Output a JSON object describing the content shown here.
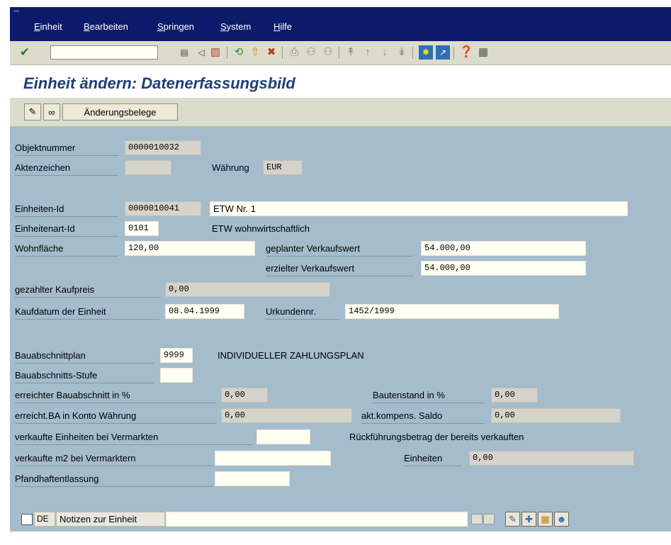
{
  "menu": {
    "items": [
      "Einheit",
      "Bearbeiten",
      "Springen",
      "System",
      "Hilfe"
    ]
  },
  "toolbar": {
    "command_value": ""
  },
  "title": "Einheit ändern: Datenerfassungsbild",
  "app_toolbar": {
    "aenderungsbelege": "Änderungsbelege"
  },
  "form": {
    "objektnummer": {
      "label": "Objektnummer",
      "value": "0000010032"
    },
    "aktenzeichen": {
      "label": "Aktenzeichen",
      "value": ""
    },
    "waehrung": {
      "label": "Währung",
      "value": "EUR"
    },
    "einheiten_id": {
      "label": "Einheiten-Id",
      "value": "0000010041",
      "text": "ETW Nr. 1"
    },
    "einheitenart_id": {
      "label": "Einheitenart-Id",
      "value": "0101",
      "text": "ETW wohnwirtschaftlich"
    },
    "wohnflaeche": {
      "label": "Wohnfläche",
      "value": "120,00"
    },
    "geplanter_vkw": {
      "label": "geplanter Verkaufswert",
      "value": "54.000,00"
    },
    "erzielter_vkw": {
      "label": "erzielter Verkaufswert",
      "value": "54.000,00"
    },
    "gezahlter_kaufpreis": {
      "label": "gezahlter Kaufpreis",
      "value": "0,00"
    },
    "kaufdatum": {
      "label": "Kaufdatum der Einheit",
      "value": "08.04.1999"
    },
    "urkundennr": {
      "label": "Urkundennr.",
      "value": "1452/1999"
    },
    "bauabschnittplan": {
      "label": "Bauabschnittplan",
      "value": "9999",
      "text": "INDIVIDUELLER ZAHLUNGSPLAN"
    },
    "bauabschnitts_stufe": {
      "label": "Bauabschnitts-Stufe",
      "value": ""
    },
    "erreichter_ba": {
      "label": "erreichter Bauabschnitt in %",
      "value": "0,00"
    },
    "bautenstand": {
      "label": "Bautenstand in %",
      "value": "0,00"
    },
    "erreicht_ba_konto": {
      "label": "erreicht.BA in Konto Währung",
      "value": "0,00"
    },
    "akt_kompens": {
      "label": "akt.kompens. Saldo",
      "value": "0,00"
    },
    "verkaufte_einheiten": {
      "label": "verkaufte Einheiten bei Vermarkten",
      "value": ""
    },
    "rueckfuehrung": {
      "label": "Rückführungsbetrag der bereits verkauften",
      "label2": "Einheiten",
      "value": "0,00"
    },
    "verkaufte_m2": {
      "label": "verkaufte m2 bei Vermarktern",
      "value": ""
    },
    "pfandhaft": {
      "label": "Pfandhaftentlassung",
      "value": ""
    }
  },
  "notes": {
    "lang": "DE",
    "label": "Notizen zur Einheit",
    "value": ""
  }
}
